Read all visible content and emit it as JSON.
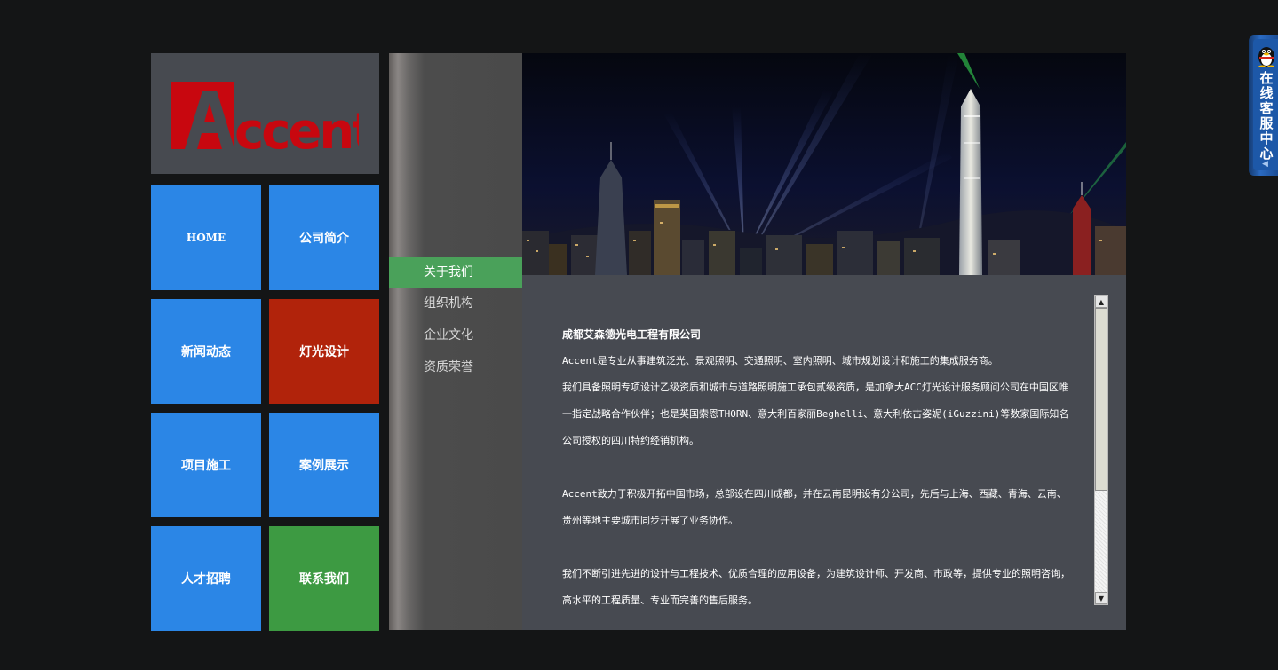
{
  "logo": {
    "text": "Accent"
  },
  "nav": {
    "home": "HOME",
    "about": "公司简介",
    "news": "新闻动态",
    "lighting": "灯光设计",
    "projects": "项目施工",
    "cases": "案例展示",
    "jobs": "人才招聘",
    "contact": "联系我们"
  },
  "subnav": {
    "items": [
      {
        "label": "关于我们",
        "active": true
      },
      {
        "label": "组织机构",
        "active": false
      },
      {
        "label": "企业文化",
        "active": false
      },
      {
        "label": "资质荣誉",
        "active": false
      }
    ]
  },
  "article": {
    "company": "成都艾森德光电工程有限公司",
    "p1": "Accent是专业从事建筑泛光、景观照明、交通照明、室内照明、城市规划设计和施工的集成服务商。",
    "p2": "我们具备照明专项设计乙级资质和城市与道路照明施工承包贰级资质，是加拿大ACC灯光设计服务顾问公司在中国区唯一指定战略合作伙伴；也是英国索恩THORN、意大利百家丽Beghelli、意大利依古姿妮(iGuzzini)等数家国际知名公司授权的四川特约经销机构。",
    "p3": "Accent致力于积极开拓中国市场，总部设在四川成都，并在云南昆明设有分公司，先后与上海、西藏、青海、云南、贵州等地主要城市同步开展了业务协作。",
    "p4": "我们不断引进先进的设计与工程技术、优质合理的应用设备，为建筑设计师、开发商、市政等，提供专业的照明咨询，高水平的工程质量、专业而完善的售后服务。"
  },
  "qq": {
    "label": "在线客服中心"
  },
  "colors": {
    "tile_blue": "#2b86e6",
    "tile_red": "#b1230b",
    "tile_green": "#3d9a42",
    "subnav_active": "#4aa15a",
    "logo_red": "#c8070f"
  }
}
